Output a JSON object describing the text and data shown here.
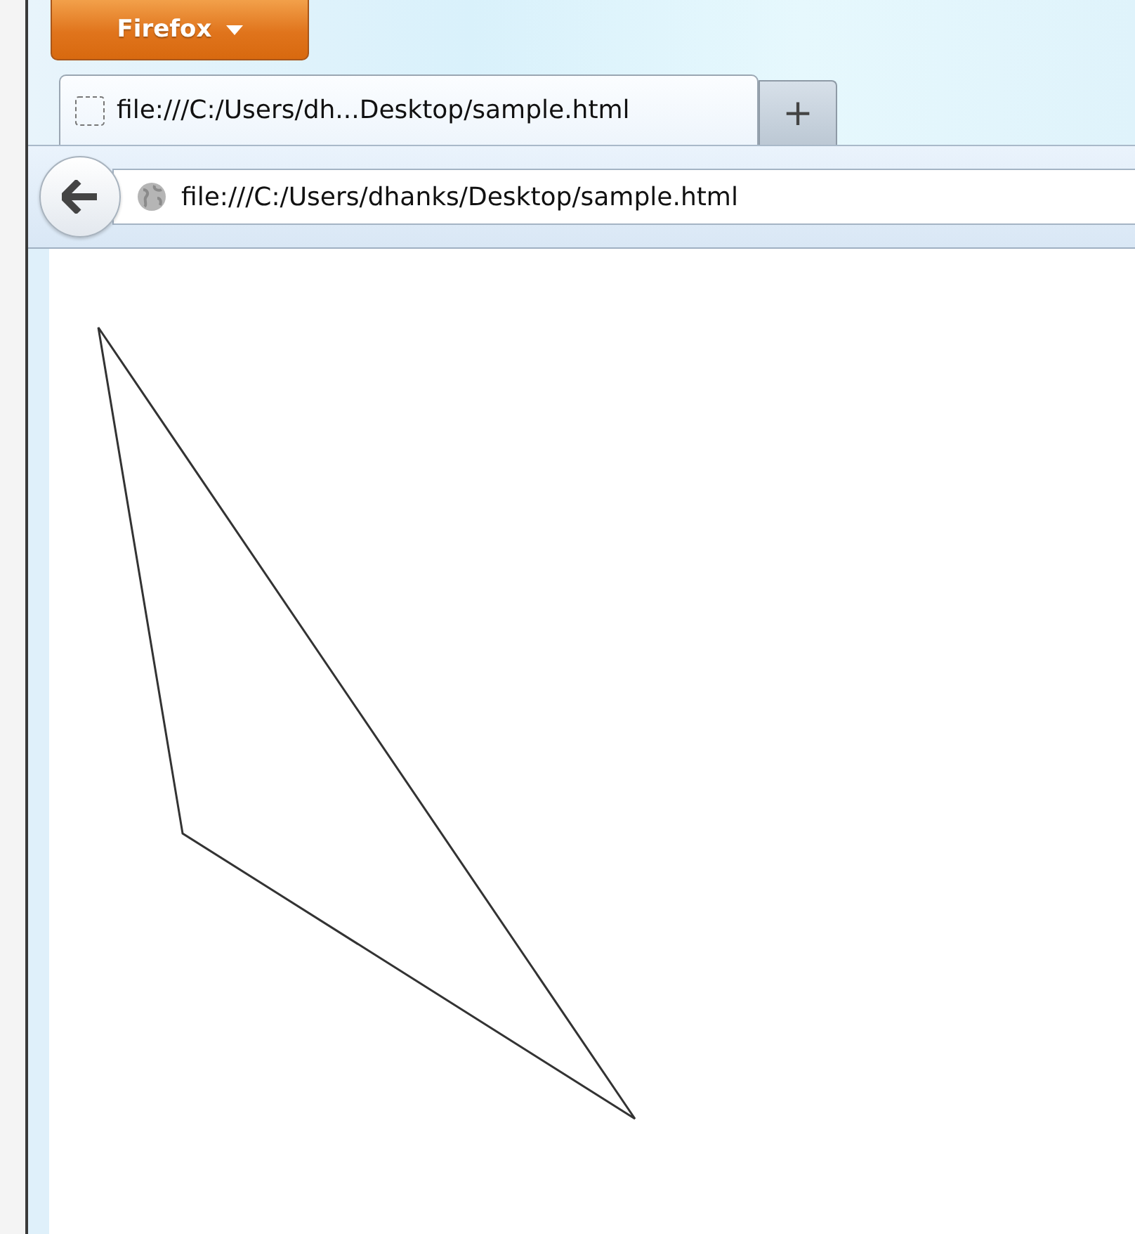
{
  "app_menu": {
    "label": "Firefox"
  },
  "tabs": [
    {
      "title": "file:///C:/Users/dh...Desktop/sample.html",
      "selected": true
    }
  ],
  "new_tab": {
    "label": "+"
  },
  "address_bar": {
    "value": "file:///C:/Users/dhanks/Desktop/sample.html"
  },
  "content": {
    "kind": "triangle"
  }
}
